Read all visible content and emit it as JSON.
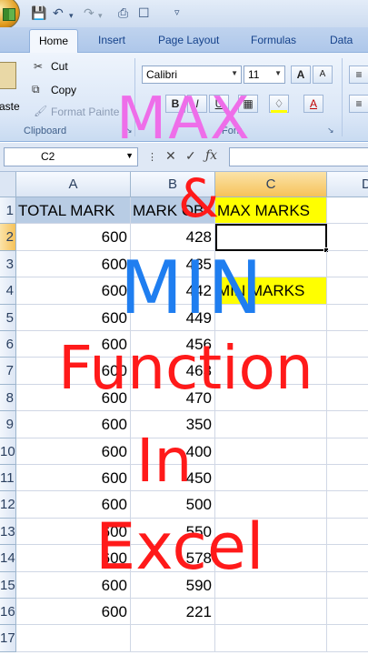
{
  "qat": {
    "save_icon": "save-icon",
    "undo_icon": "undo-icon",
    "redo_icon": "redo-icon",
    "print_icon": "print-icon",
    "preview_icon": "print-preview-icon",
    "more": "▿"
  },
  "tabs": [
    "Home",
    "Insert",
    "Page Layout",
    "Formulas",
    "Data"
  ],
  "clipboard": {
    "paste_label": "aste",
    "cut_label": "Cut",
    "copy_label": "Copy",
    "format_painter_label": "Format Painte",
    "group_label": "Clipboard"
  },
  "font": {
    "font_name": "Calibri",
    "font_size": "11",
    "group_label": "Font",
    "grow_label": "A",
    "shrink_label": "A",
    "bold_label": "B",
    "italic_label": "I",
    "underline_label": "U",
    "font_color_label": "A"
  },
  "formula_bar": {
    "name_box": "C2",
    "formula": ""
  },
  "columns": [
    "A",
    "B",
    "C",
    "D"
  ],
  "rows": [
    {
      "num": "1",
      "a": "TOTAL MARK",
      "b": "MARK OB",
      "c": "MAX MARKS"
    },
    {
      "num": "2",
      "a": "600",
      "b": "428",
      "c": ""
    },
    {
      "num": "3",
      "a": "600",
      "b": "435",
      "c": ""
    },
    {
      "num": "4",
      "a": "600",
      "b": "442",
      "c": "MIN MARKS"
    },
    {
      "num": "5",
      "a": "600",
      "b": "449",
      "c": ""
    },
    {
      "num": "6",
      "a": "600",
      "b": "456",
      "c": ""
    },
    {
      "num": "7",
      "a": "600",
      "b": "463",
      "c": ""
    },
    {
      "num": "8",
      "a": "600",
      "b": "470",
      "c": ""
    },
    {
      "num": "9",
      "a": "600",
      "b": "350",
      "c": ""
    },
    {
      "num": "10",
      "a": "600",
      "b": "400",
      "c": ""
    },
    {
      "num": "11",
      "a": "600",
      "b": "450",
      "c": ""
    },
    {
      "num": "12",
      "a": "600",
      "b": "500",
      "c": ""
    },
    {
      "num": "13",
      "a": "600",
      "b": "550",
      "c": ""
    },
    {
      "num": "14",
      "a": "600",
      "b": "578",
      "c": ""
    },
    {
      "num": "15",
      "a": "600",
      "b": "590",
      "c": ""
    },
    {
      "num": "16",
      "a": "600",
      "b": "221",
      "c": ""
    },
    {
      "num": "17",
      "a": "",
      "b": "",
      "c": ""
    }
  ],
  "overlay": {
    "line1": "MAX",
    "line2": "&",
    "line3": "MIN",
    "line4": "Function",
    "line5": "In",
    "line6": "Excel"
  },
  "colors": {
    "header_fill_blue": "#b8cce4",
    "header_fill_yellow": "#ffff00",
    "title_pink": "#ee6ee9",
    "title_blue": "#1f7ef0",
    "title_red": "#ff1a1a"
  }
}
